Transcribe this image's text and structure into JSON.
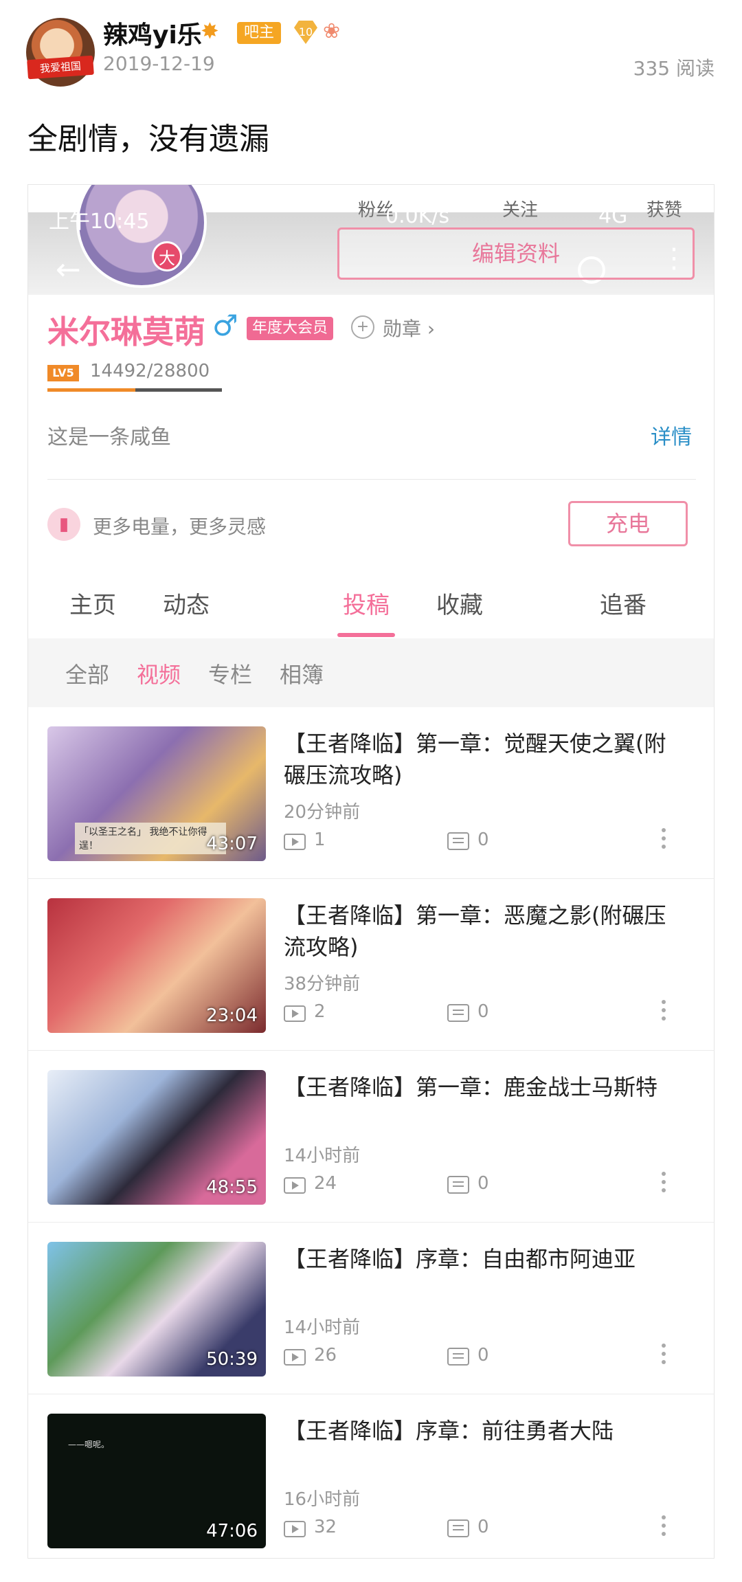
{
  "post": {
    "username": "辣鸡yi乐",
    "avatar_banner": "我爱祖国",
    "badge": "吧主",
    "level": "10",
    "date": "2019-12-19",
    "read_count": "335 阅读",
    "text": "全剧情，没有遗漏"
  },
  "screenshot": {
    "status": {
      "time": "上午10:45",
      "network": "0.0K/s",
      "signal": "4G"
    },
    "stats": {
      "fans": "粉丝",
      "follow": "关注",
      "likes": "获赞"
    },
    "edit_profile": "编辑资料",
    "vip_badge": "大",
    "profile": {
      "name": "米尔琳莫萌",
      "gender_symbol": "♂",
      "vip_label": "年度大会员",
      "medal_label": "勋章 ›",
      "level_badge": "LV5",
      "exp": "14492/28800",
      "exp_progress": 0.503,
      "bio": "这是一条咸鱼",
      "detail": "详情"
    },
    "charge": {
      "text": "更多电量，更多灵感",
      "button": "充电"
    },
    "tabs": [
      "主页",
      "动态",
      "投稿",
      "收藏",
      "追番"
    ],
    "active_tab": 2,
    "subtabs": [
      "全部",
      "视频",
      "专栏",
      "相簿"
    ],
    "active_subtab": 1,
    "videos": [
      {
        "title": "【王者降临】第一章：觉醒天使之翼(附碾压流攻略)",
        "time": "20分钟前",
        "plays": "1",
        "danmaku": "0",
        "duration": "43:07",
        "caption": "「以圣王之名」 我绝不让你得逞！"
      },
      {
        "title": "【王者降临】第一章：恶魔之影(附碾压流攻略)",
        "time": "38分钟前",
        "plays": "2",
        "danmaku": "0",
        "duration": "23:04"
      },
      {
        "title": "【王者降临】第一章：鹿金战士马斯特",
        "time": "14小时前",
        "plays": "24",
        "danmaku": "0",
        "duration": "48:55"
      },
      {
        "title": "【王者降临】序章：自由都市阿迪亚",
        "time": "14小时前",
        "plays": "26",
        "danmaku": "0",
        "duration": "50:39"
      },
      {
        "title": "【王者降临】序章：前往勇者大陆",
        "time": "16小时前",
        "plays": "32",
        "danmaku": "0",
        "duration": "47:06",
        "caption": "——嗯呢。"
      }
    ]
  }
}
